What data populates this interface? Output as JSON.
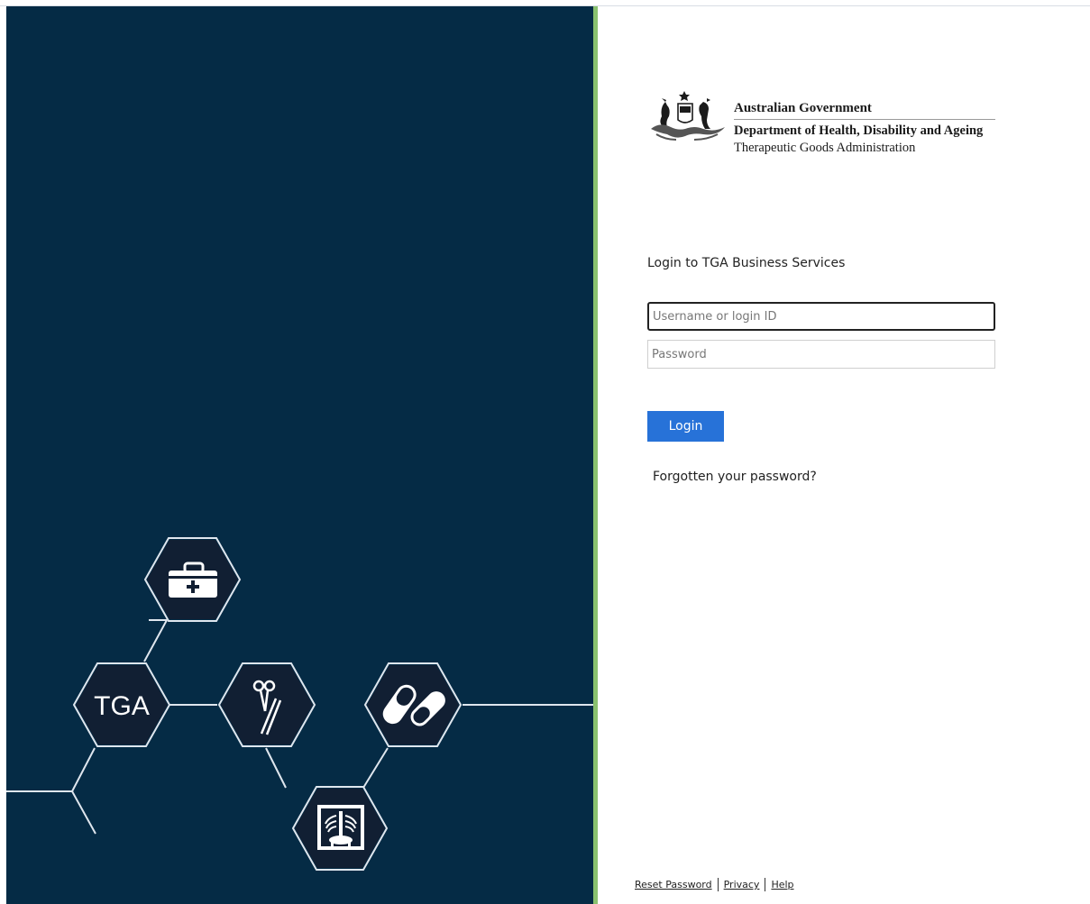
{
  "branding": {
    "government": "Australian Government",
    "department": "Department of Health, Disability and Ageing",
    "agency": "Therapeutic Goods Administration",
    "hex_logo_text": "TGA"
  },
  "login": {
    "heading": "Login to TGA Business Services",
    "username_placeholder": "Username or login ID",
    "password_placeholder": "Password",
    "button_label": "Login",
    "forgot_link": "Forgotten your password?"
  },
  "footer": {
    "links": [
      "Reset Password",
      "Privacy",
      "Help"
    ]
  },
  "colors": {
    "panel_background": "#052b45",
    "divider": "#8ac16f",
    "button": "#2772d8",
    "hex_fill": "#111f33"
  },
  "icons": [
    "medical-kit-icon",
    "surgical-tools-icon",
    "capsules-icon",
    "xray-icon",
    "coat-of-arms-icon"
  ]
}
